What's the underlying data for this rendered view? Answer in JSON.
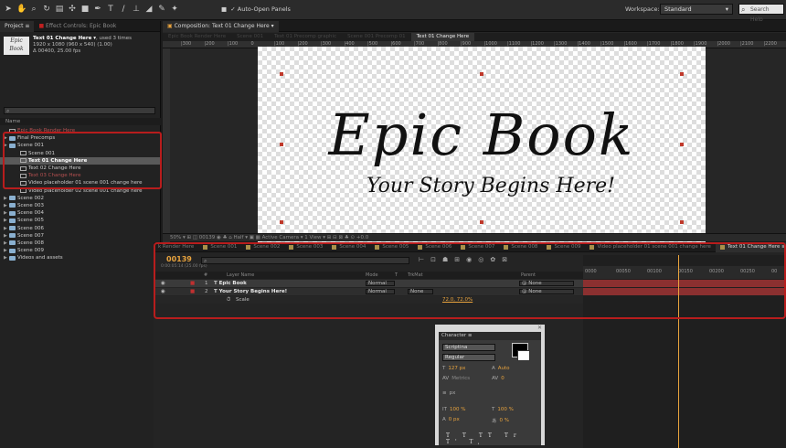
{
  "toolbar": {
    "auto_open_label": "Auto-Open Panels",
    "workspace_label": "Workspace:",
    "workspace_value": "Standard",
    "search_placeholder": "Search Help"
  },
  "project_panel": {
    "tabs": [
      "Project ≡",
      "Effect Controls: Epic Book"
    ],
    "thumb_text": "Epic Book",
    "info_title": "Text 01 Change Here ▾",
    "info_used": ", used 3 times",
    "info_dims": "1920 x 1080 (960 x 540) (1.00)",
    "info_time": "Δ 00400, 25.00 fps",
    "name_header": "Name",
    "items": [
      {
        "label": "Epic Book Render Here",
        "indent": 0,
        "type": "comp",
        "red": true,
        "sel": false
      },
      {
        "label": "Final Precomps",
        "indent": 0,
        "type": "folder",
        "red": false,
        "sel": false
      },
      {
        "label": "Scene 001",
        "indent": 0,
        "type": "folder",
        "red": false,
        "sel": false
      },
      {
        "label": "Scene 001",
        "indent": 1,
        "type": "comp",
        "red": false,
        "sel": false
      },
      {
        "label": "Text 01 Change Here",
        "indent": 1,
        "type": "comp",
        "red": false,
        "sel": true
      },
      {
        "label": "Text 02 Change Here",
        "indent": 1,
        "type": "comp",
        "red": false,
        "sel": false
      },
      {
        "label": "Text 03 Change Here",
        "indent": 1,
        "type": "comp",
        "red": true,
        "sel": false
      },
      {
        "label": "Video placeholder 01 scene 001 change here",
        "indent": 1,
        "type": "comp",
        "red": false,
        "sel": false
      },
      {
        "label": "Video placeholder 02 scene 001 change here",
        "indent": 1,
        "type": "comp",
        "red": false,
        "sel": false
      },
      {
        "label": "Scene 002",
        "indent": 0,
        "type": "folder",
        "red": false,
        "sel": false
      },
      {
        "label": "Scene 003",
        "indent": 0,
        "type": "folder",
        "red": false,
        "sel": false
      },
      {
        "label": "Scene 004",
        "indent": 0,
        "type": "folder",
        "red": false,
        "sel": false
      },
      {
        "label": "Scene 005",
        "indent": 0,
        "type": "folder",
        "red": false,
        "sel": false
      },
      {
        "label": "Scene 006",
        "indent": 0,
        "type": "folder",
        "red": false,
        "sel": false
      },
      {
        "label": "Scene 007",
        "indent": 0,
        "type": "folder",
        "red": false,
        "sel": false
      },
      {
        "label": "Scene 008",
        "indent": 0,
        "type": "folder",
        "red": false,
        "sel": false
      },
      {
        "label": "Scene 009",
        "indent": 0,
        "type": "folder",
        "red": false,
        "sel": false
      },
      {
        "label": "Videos and assets",
        "indent": 0,
        "type": "folder",
        "red": false,
        "sel": false
      }
    ]
  },
  "comp_viewer": {
    "tab_label": "Composition: Text 01 Change Here ▾",
    "flow": [
      "Epic Book Render Here",
      "Scene 001",
      "Text 01 Precomp graphic",
      "Scene 001 Precomp 01",
      "Text 01 Change Here"
    ],
    "ruler_ticks": [
      "|300",
      "|200",
      "|100",
      "0",
      "|100",
      "|200",
      "|300",
      "|400",
      "|500",
      "|600",
      "|700",
      "|800",
      "|900",
      "|1000",
      "|1100",
      "|1200",
      "|1300",
      "|1400",
      "|1500",
      "|1600",
      "|1700",
      "|1800",
      "|1900",
      "|2000",
      "|2100",
      "|2200"
    ],
    "title_text": "Epic Book",
    "subtitle_text": "Your Story Begins Here!",
    "view_bar": "50%  ▾  ⊞  ◫  00139  ◉  ♣  ⌂  Half  ▾  ▣  ▦  Active Camera  ▾  1 View  ▾  ⊞  ⊟  ⊠  ♣  ⊙  +0.0"
  },
  "timeline": {
    "tabs": [
      {
        "label": "k Render Here",
        "active": false
      },
      {
        "label": "Scene 001",
        "active": false
      },
      {
        "label": "Scene 002",
        "active": false
      },
      {
        "label": "Scene 003",
        "active": false
      },
      {
        "label": "Scene 004",
        "active": false
      },
      {
        "label": "Scene 005",
        "active": false
      },
      {
        "label": "Scene 006",
        "active": false
      },
      {
        "label": "Scene 007",
        "active": false
      },
      {
        "label": "Scene 008",
        "active": false
      },
      {
        "label": "Scene 009",
        "active": false
      },
      {
        "label": "Video placeholder 01 scene 001 change here",
        "active": false
      },
      {
        "label": "Text 01 Change Here ≡",
        "active": true
      }
    ],
    "current_time": "00139",
    "fps_info": "0:00:05:14 (25.00 fps)",
    "header": {
      "num": "#",
      "layer_name": "Layer Name",
      "mode": "Mode",
      "t": "T",
      "trkmat": "TrkMat",
      "parent": "Parent"
    },
    "layers": [
      {
        "num": "1",
        "name": "Epic Book",
        "mode": "Normal",
        "trkmat": "",
        "parent": "None"
      },
      {
        "num": "2",
        "name": "Your Story Begins Here!",
        "mode": "Normal",
        "trkmat": "None",
        "parent": "None"
      }
    ],
    "prop_name": "Scale",
    "prop_value": "72.0, 72.0%",
    "track_ruler": [
      "0000",
      "00050",
      "00100",
      "00150",
      "00200",
      "00250",
      "00"
    ]
  },
  "character": {
    "title": "Character ≡",
    "font": "Scriptina",
    "style": "Regular",
    "size": "127 px",
    "leading": "Auto",
    "kerning": "Metrics",
    "tracking": "0",
    "stroke_unit": "px",
    "vscale": "100 %",
    "hscale": "100 %",
    "baseline": "0 px",
    "tsume": "0 %",
    "style_buttons": "T T TT Tr T' T,"
  }
}
